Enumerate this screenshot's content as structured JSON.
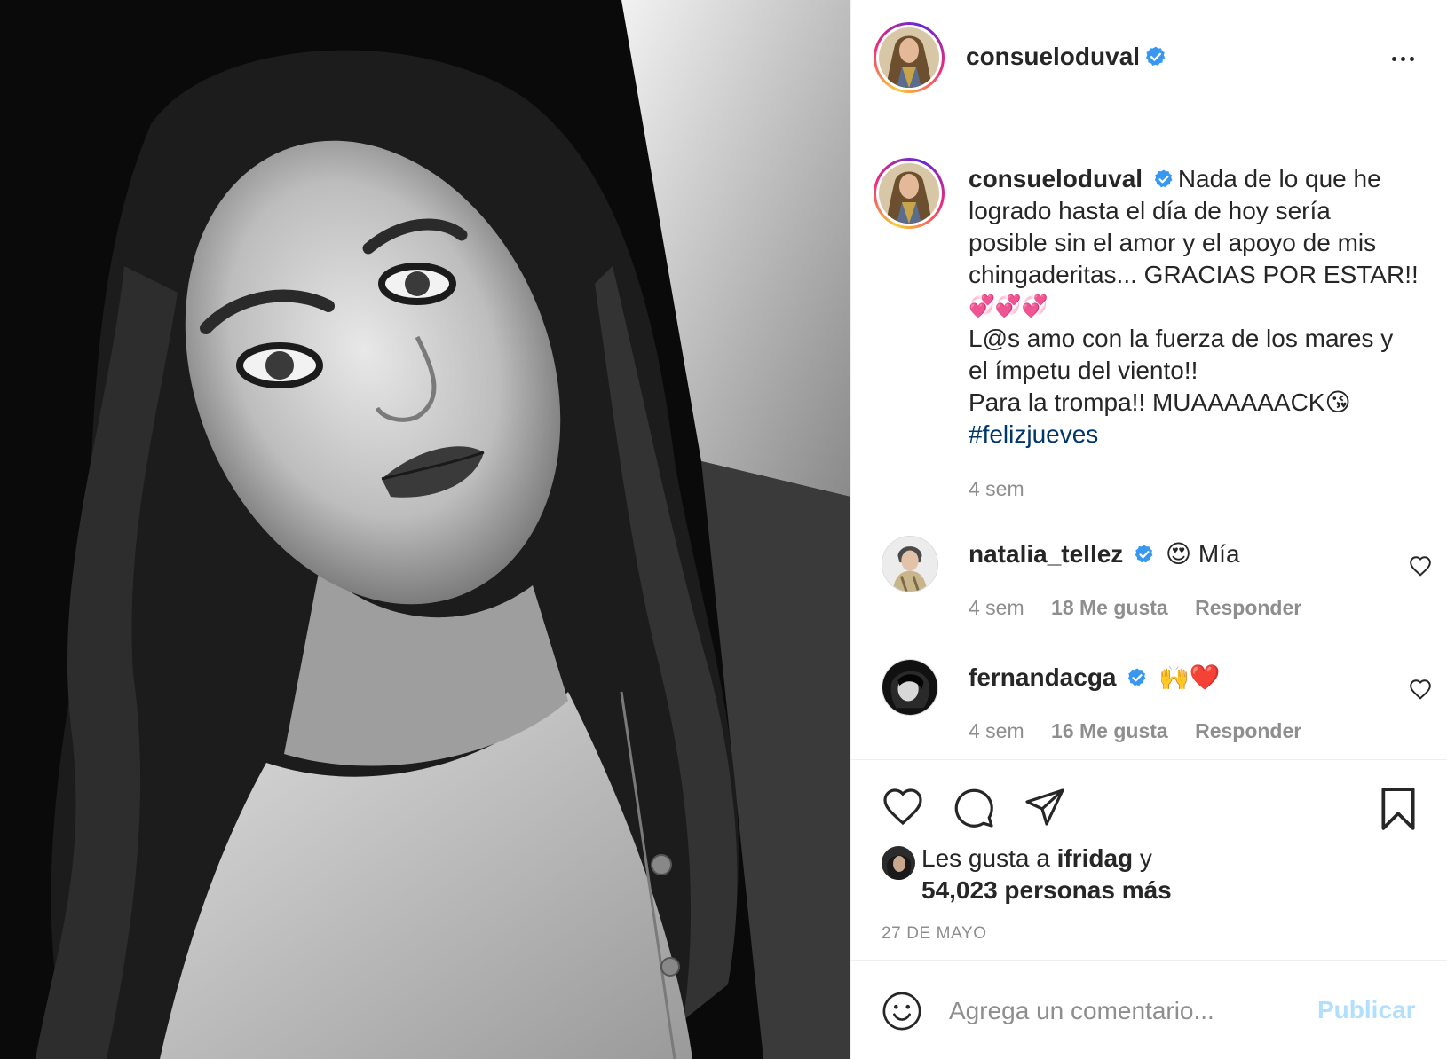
{
  "post": {
    "author": "consueloduval",
    "caption_lines": [
      "Nada de lo que he",
      "logrado hasta el día de hoy sería",
      "posible sin el amor y el apoyo de mis",
      "chingaderitas... GRACIAS POR ESTAR!!"
    ],
    "caption_hearts": "💞💞💞",
    "caption_line2": "L@s amo con la fuerza de los mares y",
    "caption_line3": "el ímpetu del viento!!",
    "caption_line4": "Para la trompa!! MUAAAAAACK😘",
    "hashtag": "#felizjueves",
    "time": "4 sem",
    "likes_prefix": "Les gusta a",
    "likes_user": "ifridag",
    "likes_join": "y",
    "likes_count": "54,023 personas más",
    "date": "27 DE MAYO"
  },
  "comments": [
    {
      "user": "natalia_tellez",
      "text": "😍 Mía",
      "time": "4 sem",
      "likes": "18 Me gusta",
      "reply": "Responder"
    },
    {
      "user": "fernandacga",
      "text": "🙌❤️",
      "time": "4 sem",
      "likes": "16 Me gusta",
      "reply": "Responder"
    }
  ],
  "input": {
    "placeholder": "Agrega un comentario...",
    "publish": "Publicar"
  },
  "colors": {
    "verified": "#3897f0",
    "hashtag": "#00376b",
    "muted": "#8e8e8e",
    "publish_disabled": "#b2dffc"
  },
  "icons": {
    "verified": "verified-badge-icon",
    "more": "more-options-icon",
    "like": "heart-icon",
    "comment": "comment-bubble-icon",
    "share": "paper-plane-icon",
    "save": "bookmark-icon",
    "emoji": "smiley-icon"
  }
}
